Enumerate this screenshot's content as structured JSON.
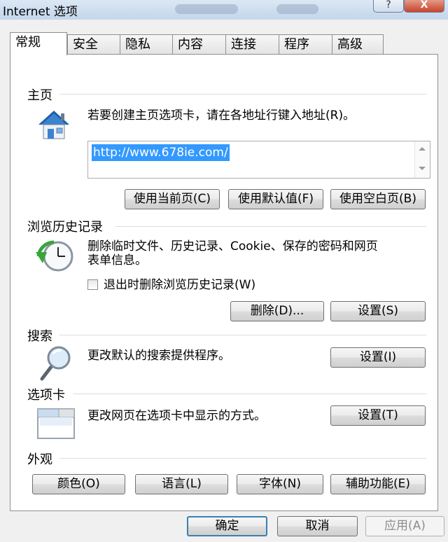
{
  "window": {
    "title": "Internet 选项",
    "help_label": "?",
    "close_label": "X"
  },
  "tabs": [
    {
      "label": "常规"
    },
    {
      "label": "安全"
    },
    {
      "label": "隐私"
    },
    {
      "label": "内容"
    },
    {
      "label": "连接"
    },
    {
      "label": "程序"
    },
    {
      "label": "高级"
    }
  ],
  "homepage": {
    "title": "主页",
    "description": "若要创建主页选项卡，请在各地址行键入地址(R)。",
    "url": "http://www.678ie.com/",
    "use_current": "使用当前页(C)",
    "use_default": "使用默认值(F)",
    "use_blank": "使用空白页(B)"
  },
  "history": {
    "title": "浏览历史记录",
    "description_line1": "删除临时文件、历史记录、Cookie、保存的密码和网页",
    "description_line2": "表单信息。",
    "checkbox_label": "退出时删除浏览历史记录(W)",
    "delete_button": "删除(D)...",
    "settings_button": "设置(S)"
  },
  "search": {
    "title": "搜索",
    "description": "更改默认的搜索提供程序。",
    "settings_button": "设置(I)"
  },
  "tabs_section": {
    "title": "选项卡",
    "description": "更改网页在选项卡中显示的方式。",
    "settings_button": "设置(T)"
  },
  "appearance": {
    "title": "外观",
    "colors": "颜色(O)",
    "languages": "语言(L)",
    "fonts": "字体(N)",
    "accessibility": "辅助功能(E)"
  },
  "footer": {
    "ok": "确定",
    "cancel": "取消",
    "apply": "应用(A)"
  },
  "colors": {
    "selection": "#3399ff",
    "default_border": "#3c7fb1",
    "close_button": "#c7442b"
  }
}
